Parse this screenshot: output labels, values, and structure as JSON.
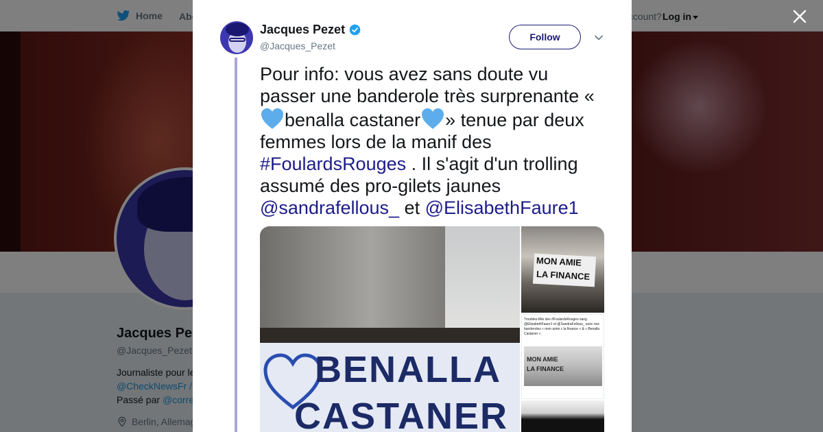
{
  "nav": {
    "home_label": "Home",
    "about_label": "Abo",
    "account_text": "account?",
    "login_label": "Log in"
  },
  "profile": {
    "name": "Jacques Pe",
    "handle": "@Jacques_Pezet",
    "bio_line1": "Journaliste pour le",
    "bio_line2": "@CheckNewsFr /",
    "bio_line3_prefix": "Passé par",
    "bio_line3_link": "@corre",
    "location": "Berlin, Allemag"
  },
  "tweet": {
    "author_name": "Jacques Pezet",
    "author_handle": "@Jacques_Pezet",
    "follow_label": "Follow",
    "text_part1": "Pour info: vous avez sans doute vu passer une banderole très surprenante «",
    "text_part2": "benalla castaner",
    "text_part3": "» tenue par deux femmes lors de la manif des",
    "hashtag": "#FoulardsRouges",
    "text_part4": ". Il s'agit d'un trolling assumé des pro-gilets jaunes",
    "mention1": "@sandrafellous_",
    "text_part5": "et",
    "mention2": "@ElisabethFaure1"
  },
  "media": {
    "main_banner_word1": "BENALLA",
    "main_banner_word2": "CASTANER",
    "thumb1_sign_line1": "MON AMIE",
    "thumb1_sign_line2": "LA FINANCE",
    "thumb2_tweet_text": "Troubles-fête des #FoulardsRouges sang @ElisabethFaure1 et @SandraFellous_ avec nos banderoles « mon amie c la finance » & « Benalla Castaner ».",
    "thumb2_photo_text1": "MON AMIE",
    "thumb2_photo_text2": "LA FINANCE"
  },
  "colors": {
    "accent": "#1c1c8a",
    "heart": "#5dadec",
    "twitter_blue": "#1da1f2"
  },
  "icons": {
    "close": "close-icon",
    "verified": "verified-badge-icon",
    "chevron": "chevron-down-icon",
    "bird": "twitter-bird-icon",
    "location": "location-pin-icon"
  }
}
